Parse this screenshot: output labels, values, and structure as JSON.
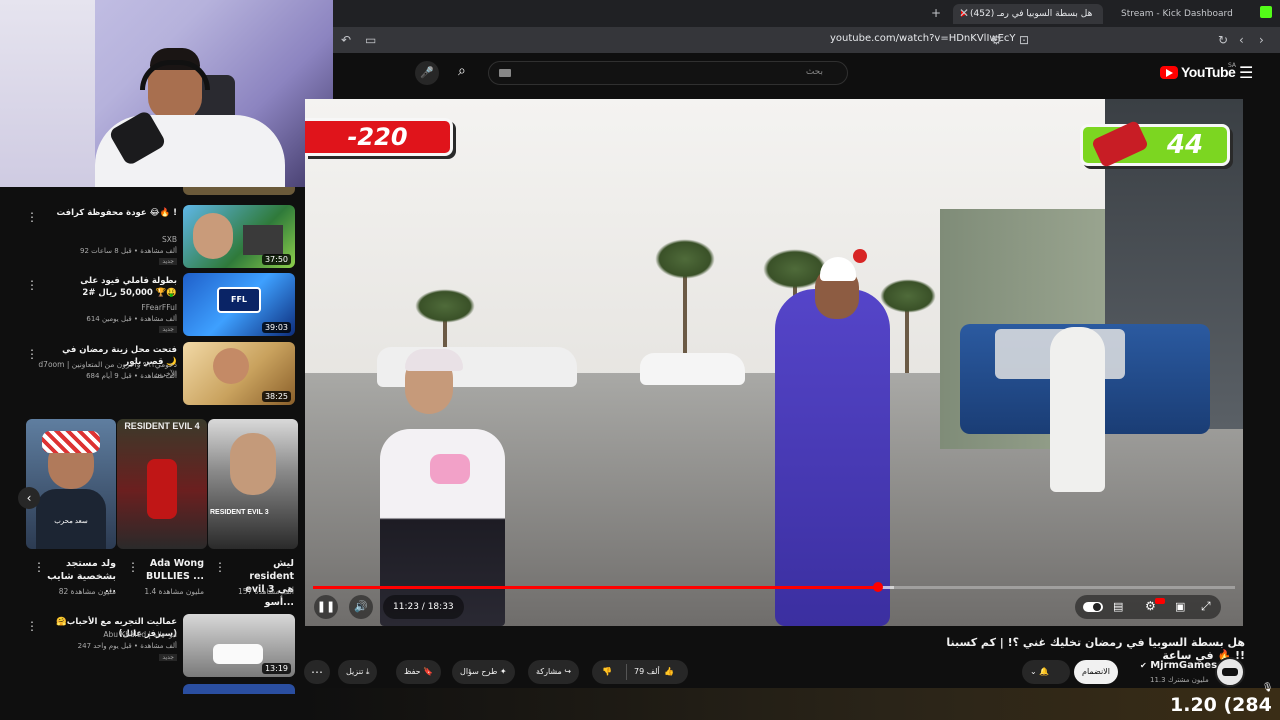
{
  "browser": {
    "tabs": [
      {
        "label": "Stream - Kick Dashboard",
        "active": false
      },
      {
        "label": "(452) هل بسطة السوبيا في رمـ",
        "active": true
      }
    ],
    "url": "youtube.com/watch?v=HDnKVlIwEcY"
  },
  "youtube": {
    "logo_text": "YouTube",
    "region": "SA",
    "search_placeholder": "بحث"
  },
  "video": {
    "score_left": "-220",
    "score_right": "44",
    "current_time": "11:23",
    "duration": "18:33",
    "time_separator": " / ",
    "progress_fraction": 0.613,
    "buffered_fraction": 0.63,
    "title": "هل بسطة السوبيا في رمضان تخليك غني ؟! | كم كسبنا في ساعة 🔥 !!",
    "channel": {
      "name": "MjrmGames",
      "subscribers": "11.3 مليون مشترك",
      "join_label": "الانضمام"
    },
    "actions": {
      "likes": "79 ألف",
      "share": "مشاركة",
      "ask": "طرح سؤال",
      "save": "حفظ",
      "download": "تنزيل"
    }
  },
  "recommendations": [
    {
      "title": "عودة محفوظة كرافت 😂🔥 !",
      "channel": "SXB",
      "meta": "92 ألف مشاهدة • قبل 8 ساعات",
      "duration": "37:50",
      "badge": "جديد"
    },
    {
      "title": "بطولة فاملي فيود على 50,000 ريال #2 🏆🤑",
      "channel": "FFearFFul",
      "meta": "614 ألف مشاهدة • قبل يومين",
      "duration": "39:03",
      "badge": "جديد"
    },
    {
      "title": "فتحت محل زينة رمضان في قصر بلور 🌙",
      "channel": "d7oom | دحومي٩٩١ وآخرون من المتعاونين الآخرين",
      "meta": "684 ألف مشاهدة • قبل 9 أيام",
      "duration": "38:25",
      "badge": ""
    },
    {
      "title": "عمالیت التجربه مع الأحباب🤗(سيرفر عائل)",
      "channel": "Abu Khaled | ابو خالد",
      "meta": "247 ألف مشاهدة • قبل يوم واحد",
      "duration": "13:19",
      "badge": "جديد"
    }
  ],
  "shorts": [
    {
      "title": "ولد مستجد بشخصية شايب ...",
      "views": "82 مليون مشاهدة"
    },
    {
      "title": "Ada Wong BULLIES ...",
      "views": "1.4 مليون مشاهدة"
    },
    {
      "title": "ليش resident evil 3 هي أسو...",
      "views": "157 ألف مشاهدة"
    }
  ],
  "shorts_thumbs": [
    {
      "caption": "سعد محرب"
    },
    {
      "caption": "RESIDENT EVIL 4"
    },
    {
      "caption": "RESIDENT EVIL 3"
    }
  ],
  "overlay_counter": "1.20 (284",
  "colors": {
    "yt_red": "#ff0000",
    "score_red": "#e0141b",
    "score_green": "#7cd621"
  }
}
